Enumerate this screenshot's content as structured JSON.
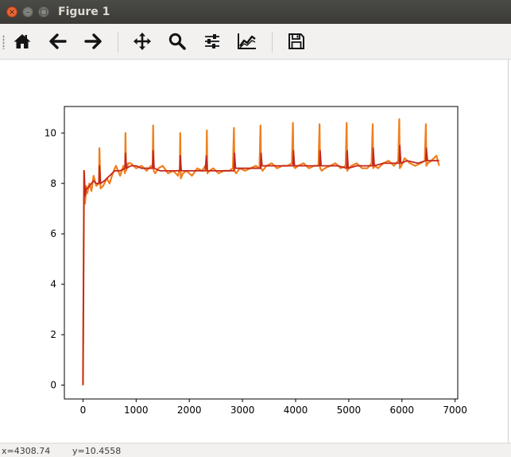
{
  "window": {
    "title": "Figure 1",
    "close_glyph": "×",
    "min_glyph": "–",
    "max_glyph": "□"
  },
  "toolbar": {
    "buttons": [
      {
        "name": "home-button",
        "icon": "home-icon"
      },
      {
        "name": "back-button",
        "icon": "arrow-left-icon"
      },
      {
        "name": "forward-button",
        "icon": "arrow-right-icon"
      },
      {
        "name": "pan-button",
        "icon": "move-icon"
      },
      {
        "name": "zoom-button",
        "icon": "magnifier-icon"
      },
      {
        "name": "subplots-button",
        "icon": "sliders-icon"
      },
      {
        "name": "edit-axes-button",
        "icon": "line-chart-icon"
      },
      {
        "name": "save-button",
        "icon": "floppy-icon"
      }
    ]
  },
  "status": {
    "x_readout": "x=4308.74",
    "y_readout": "y=10.4558"
  },
  "chart_data": {
    "type": "line",
    "title": "",
    "xlabel": "",
    "ylabel": "",
    "xlim": [
      -350,
      7050
    ],
    "ylim": [
      -0.55,
      11.05
    ],
    "x_ticks": [
      0,
      1000,
      2000,
      3000,
      4000,
      5000,
      6000,
      7000
    ],
    "x_tick_labels": [
      "0",
      "1000",
      "2000",
      "3000",
      "4000",
      "5000",
      "6000",
      "7000"
    ],
    "y_ticks": [
      0,
      2,
      4,
      6,
      8,
      10
    ],
    "y_tick_labels": [
      "0",
      "2",
      "4",
      "6",
      "8",
      "10"
    ],
    "grid": false,
    "colors": {
      "raw": "#f07f1d",
      "smoothed": "#c4271f",
      "axes": "#000000"
    },
    "series": [
      {
        "style": "raw",
        "x": [
          0,
          20,
          40,
          60,
          80,
          120,
          160,
          200,
          250,
          300,
          310,
          330,
          380,
          450,
          500,
          560,
          620,
          700,
          760,
          790,
          800,
          810,
          850,
          900,
          1000,
          1100,
          1200,
          1280,
          1310,
          1320,
          1330,
          1360,
          1420,
          1500,
          1600,
          1700,
          1790,
          1820,
          1830,
          1840,
          1880,
          1950,
          2050,
          2150,
          2240,
          2300,
          2320,
          2330,
          2340,
          2380,
          2450,
          2550,
          2650,
          2750,
          2820,
          2840,
          2850,
          2880,
          2950,
          3050,
          3150,
          3250,
          3320,
          3340,
          3350,
          3380,
          3450,
          3550,
          3650,
          3750,
          3850,
          3930,
          3950,
          3960,
          3990,
          4050,
          4150,
          4250,
          4350,
          4430,
          4450,
          4460,
          4490,
          4550,
          4650,
          4750,
          4850,
          4940,
          4960,
          4970,
          5000,
          5050,
          5150,
          5250,
          5350,
          5430,
          5450,
          5460,
          5490,
          5550,
          5650,
          5750,
          5850,
          5930,
          5950,
          5960,
          5990,
          6050,
          6150,
          6250,
          6350,
          6430,
          6450,
          6460,
          6490,
          6550,
          6650,
          6700
        ],
        "y": [
          0.0,
          8.5,
          7.2,
          7.9,
          7.6,
          8.0,
          7.7,
          8.3,
          7.9,
          8.0,
          9.4,
          7.8,
          7.9,
          8.2,
          8.0,
          8.4,
          8.7,
          8.3,
          8.7,
          8.4,
          10.0,
          8.5,
          8.8,
          8.8,
          8.6,
          8.7,
          8.5,
          8.7,
          8.6,
          10.3,
          8.5,
          8.4,
          8.6,
          8.7,
          8.4,
          8.5,
          8.3,
          8.6,
          10.0,
          8.2,
          8.4,
          8.5,
          8.3,
          8.6,
          8.5,
          8.7,
          8.5,
          10.1,
          8.4,
          8.5,
          8.6,
          8.4,
          8.5,
          8.5,
          8.6,
          10.2,
          8.5,
          8.4,
          8.6,
          8.5,
          8.6,
          8.7,
          8.6,
          10.3,
          8.6,
          8.5,
          8.7,
          8.8,
          8.6,
          8.7,
          8.7,
          8.8,
          10.4,
          8.7,
          8.6,
          8.7,
          8.8,
          8.6,
          8.7,
          8.7,
          10.35,
          8.6,
          8.5,
          8.6,
          8.7,
          8.8,
          8.6,
          8.7,
          10.4,
          8.5,
          8.6,
          8.7,
          8.8,
          8.6,
          8.6,
          8.8,
          10.35,
          8.6,
          8.7,
          8.6,
          8.8,
          8.9,
          8.7,
          8.9,
          10.55,
          8.6,
          8.7,
          9.0,
          8.8,
          8.7,
          8.8,
          8.9,
          10.35,
          8.7,
          8.8,
          8.9,
          9.1,
          8.7
        ]
      },
      {
        "style": "smoothed",
        "x": [
          0,
          20,
          40,
          60,
          80,
          120,
          160,
          200,
          250,
          300,
          310,
          330,
          400,
          500,
          600,
          700,
          790,
          800,
          820,
          900,
          1000,
          1100,
          1200,
          1310,
          1320,
          1340,
          1450,
          1600,
          1700,
          1820,
          1830,
          1850,
          1950,
          2100,
          2300,
          2320,
          2340,
          2450,
          2650,
          2840,
          2850,
          2870,
          3000,
          3200,
          3340,
          3350,
          3370,
          3500,
          3700,
          3950,
          3960,
          3980,
          4150,
          4300,
          4450,
          4460,
          4480,
          4650,
          4800,
          4960,
          4970,
          4990,
          5150,
          5300,
          5450,
          5460,
          5480,
          5650,
          5800,
          5950,
          5960,
          5980,
          6100,
          6300,
          6450,
          6460,
          6480,
          6600,
          6700
        ],
        "y": [
          0.0,
          8.5,
          7.5,
          7.8,
          7.8,
          7.9,
          8.0,
          8.1,
          8.0,
          8.0,
          8.7,
          8.0,
          8.1,
          8.3,
          8.5,
          8.5,
          8.6,
          9.2,
          8.6,
          8.7,
          8.7,
          8.6,
          8.6,
          8.6,
          9.3,
          8.6,
          8.5,
          8.5,
          8.5,
          8.5,
          9.1,
          8.5,
          8.5,
          8.5,
          8.5,
          9.1,
          8.5,
          8.5,
          8.5,
          8.5,
          9.2,
          8.6,
          8.6,
          8.6,
          8.6,
          9.2,
          8.7,
          8.7,
          8.7,
          8.7,
          9.3,
          8.7,
          8.7,
          8.7,
          8.7,
          9.3,
          8.7,
          8.7,
          8.7,
          8.6,
          9.3,
          8.6,
          8.7,
          8.7,
          8.7,
          9.4,
          8.7,
          8.8,
          8.8,
          8.8,
          9.5,
          8.8,
          8.9,
          8.8,
          8.9,
          9.4,
          8.9,
          8.9,
          8.9
        ]
      }
    ]
  }
}
